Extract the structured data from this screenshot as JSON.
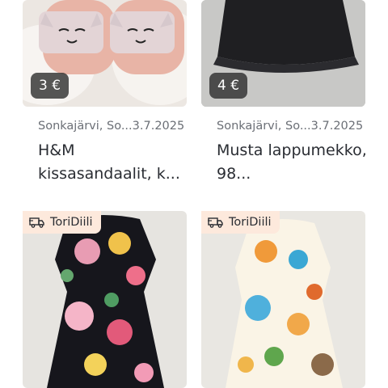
{
  "items": [
    {
      "price": "3 €",
      "location_date": "Sonkajärvi, So...3.7.2025",
      "title": "H&M kissasandaalit, k..."
    },
    {
      "price": "4 €",
      "location_date": "Sonkajärvi, So...3.7.2025",
      "title": "Musta lappumekko, 98..."
    },
    {
      "badge": "ToriDiili"
    },
    {
      "badge": "ToriDiili"
    }
  ],
  "colors": {
    "badge_bg": "#fde9dc",
    "price_bg": "#3a3a3a",
    "text": "#2a2d33",
    "meta": "#6b6f76"
  },
  "icons": {
    "badge_icon": "delivery-truck-icon"
  }
}
